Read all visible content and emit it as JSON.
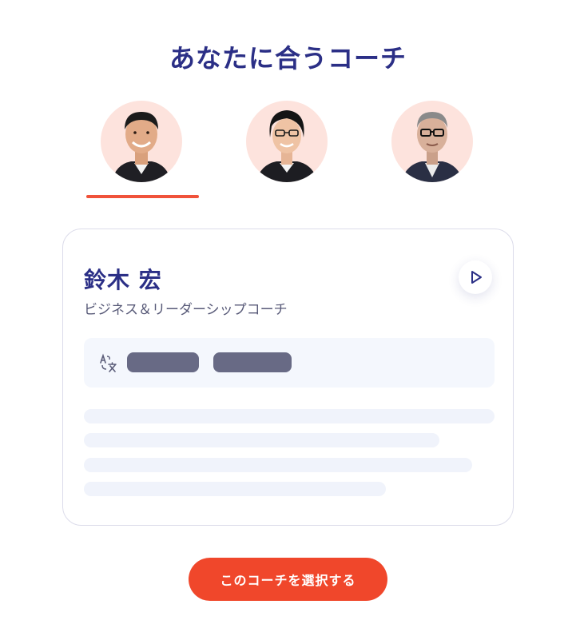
{
  "header": {
    "title": "あなたに合うコーチ"
  },
  "coaches": [
    {
      "avatar": "coach-avatar-male-smiling",
      "selected": true
    },
    {
      "avatar": "coach-avatar-female-glasses",
      "selected": false
    },
    {
      "avatar": "coach-avatar-male-glasses",
      "selected": false
    }
  ],
  "card": {
    "name": "鈴木 宏",
    "role": "ビジネス＆リーダーシップコーチ",
    "play_icon": "play-icon",
    "language_icon": "translate-icon"
  },
  "action": {
    "select_label": "このコーチを選択する"
  },
  "colors": {
    "accent": "#f0472b",
    "title": "#2b2f86",
    "avatar_background": "#fde3dd"
  }
}
